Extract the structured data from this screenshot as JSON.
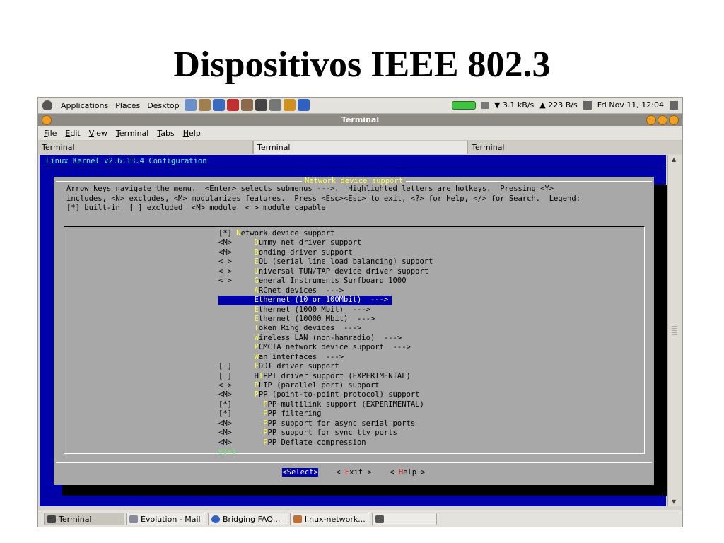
{
  "slide": {
    "title": "Dispositivos IEEE 802.3"
  },
  "panel": {
    "menus": [
      "Applications",
      "Places",
      "Desktop"
    ],
    "net_down": "3.1 kB/s",
    "net_up": "223 B/s",
    "clock": "Fri Nov 11, 12:04",
    "launcher_colors": [
      "#6a8fc9",
      "#a08050",
      "#3a6ac0",
      "#c03030",
      "#8a6a4a",
      "#444444",
      "#777777",
      "#d09020",
      "#3060c0"
    ]
  },
  "window": {
    "title": "Terminal",
    "menu": [
      "File",
      "Edit",
      "View",
      "Terminal",
      "Tabs",
      "Help"
    ],
    "tabs": [
      "Terminal",
      "Terminal",
      "Terminal"
    ]
  },
  "kconfig": {
    "header": "Linux Kernel v2.6.13.4 Configuration",
    "dialog_title": "Network device support",
    "help_lines": [
      "Arrow keys navigate the menu.  <Enter> selects submenus --->.  Highlighted letters are hotkeys.  Pressing <Y>",
      "includes, <N> excludes, <M> modularizes features.  Press <Esc><Esc> to exit, <?> for Help, </> for Search.  Legend:",
      "[*] built-in  [ ] excluded  <M> module  < > module capable"
    ],
    "items": [
      {
        "pre": "[*] ",
        "hot": "N",
        "rest": "etwork device support",
        "mid": true
      },
      {
        "pre": "<M>     ",
        "hot": "D",
        "rest": "ummy net driver support"
      },
      {
        "pre": "<M>     ",
        "hot": "B",
        "rest": "onding driver support"
      },
      {
        "pre": "< >     ",
        "hot": "E",
        "rest": "QL (serial line load balancing) support"
      },
      {
        "pre": "< >     ",
        "hot": "U",
        "rest": "niversal TUN/TAP device driver support"
      },
      {
        "pre": "< >     ",
        "hot": "G",
        "rest": "eneral Instruments Surfboard 1000"
      },
      {
        "pre": "        ",
        "hot": "A",
        "rest": "RCnet devices  --->"
      },
      {
        "pre": "        ",
        "hot": "",
        "rest": "Ethernet (10 or 100Mbit)  --->",
        "selected": true
      },
      {
        "pre": "        ",
        "hot": "E",
        "rest": "thernet (1000 Mbit)  --->"
      },
      {
        "pre": "        ",
        "hot": "E",
        "rest": "thernet (10000 Mbit)  --->"
      },
      {
        "pre": "        ",
        "hot": "T",
        "rest": "oken Ring devices  --->"
      },
      {
        "pre": "        ",
        "hot": "W",
        "rest": "ireless LAN (non-hamradio)  --->"
      },
      {
        "pre": "        ",
        "hot": "P",
        "rest": "CMCIA network device support  --->"
      },
      {
        "pre": "        ",
        "hot": "W",
        "rest": "an interfaces  --->"
      },
      {
        "pre": "[ ]     ",
        "hot": "F",
        "rest": "DDI driver support"
      },
      {
        "pre": "[ ]     H",
        "hot": "I",
        "rest": "PPI driver support (EXPERIMENTAL)"
      },
      {
        "pre": "< >     ",
        "hot": "P",
        "rest": "LIP (parallel port) support"
      },
      {
        "pre": "<M>     ",
        "hot": "P",
        "rest": "PP (point-to-point protocol) support"
      },
      {
        "pre": "[*]       ",
        "hot": "P",
        "rest": "PP multilink support (EXPERIMENTAL)"
      },
      {
        "pre": "[*]       ",
        "hot": "P",
        "rest": "PP filtering"
      },
      {
        "pre": "<M>       ",
        "hot": "P",
        "rest": "PP support for async serial ports"
      },
      {
        "pre": "<M>       ",
        "hot": "P",
        "rest": "PP support for sync tty ports"
      },
      {
        "pre": "<M>       ",
        "hot": "P",
        "rest": "PP Deflate compression"
      }
    ],
    "more_indicator": "v(+)",
    "buttons": {
      "select": "<Select>",
      "exit_pre": "< ",
      "exit_hot": "E",
      "exit_rest": "xit >",
      "help_pre": "< ",
      "help_hot": "H",
      "help_rest": "elp >"
    }
  },
  "taskbar": {
    "tasks": [
      "Terminal",
      "Evolution - Mail",
      "Bridging FAQ...",
      "linux-network..."
    ]
  }
}
